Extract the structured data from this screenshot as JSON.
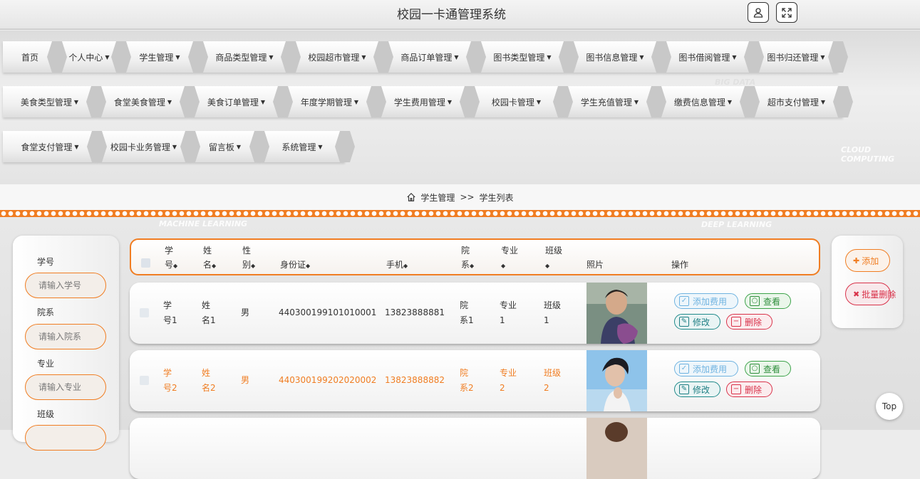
{
  "header": {
    "title": "校园一卡通管理系统",
    "user_icon": "user-icon",
    "fullscreen_icon": "expand-icon"
  },
  "nav": {
    "rows": [
      [
        {
          "label": "首页",
          "dropdown": false
        },
        {
          "label": "个人中心",
          "dropdown": true
        },
        {
          "label": "学生管理",
          "dropdown": true
        },
        {
          "label": "商品类型管理",
          "dropdown": true
        },
        {
          "label": "校园超市管理",
          "dropdown": true
        },
        {
          "label": "商品订单管理",
          "dropdown": true
        },
        {
          "label": "图书类型管理",
          "dropdown": true
        },
        {
          "label": "图书信息管理",
          "dropdown": true
        },
        {
          "label": "图书借阅管理",
          "dropdown": true
        },
        {
          "label": "图书归还管理",
          "dropdown": true
        }
      ],
      [
        {
          "label": "美食类型管理",
          "dropdown": true
        },
        {
          "label": "食堂美食管理",
          "dropdown": true
        },
        {
          "label": "美食订单管理",
          "dropdown": true
        },
        {
          "label": "年度学期管理",
          "dropdown": true
        },
        {
          "label": "学生费用管理",
          "dropdown": true
        },
        {
          "label": "校园卡管理",
          "dropdown": true
        },
        {
          "label": "学生充值管理",
          "dropdown": true
        },
        {
          "label": "缴费信息管理",
          "dropdown": true
        },
        {
          "label": "超市支付管理",
          "dropdown": true
        }
      ],
      [
        {
          "label": "食堂支付管理",
          "dropdown": true
        },
        {
          "label": "校园卡业务管理",
          "dropdown": true
        },
        {
          "label": "留言板",
          "dropdown": true
        },
        {
          "label": "系统管理",
          "dropdown": true
        }
      ]
    ],
    "deco": [
      "CLOUD COMPUTING",
      "BIG DATA",
      "MACHINE LEARNING",
      "DEEP LEARNING"
    ]
  },
  "breadcrumb": {
    "icon": "home-icon",
    "section": "学生管理",
    "sep": ">>",
    "page": "学生列表"
  },
  "search": {
    "fields": [
      {
        "label": "学号",
        "placeholder": "请输入学号"
      },
      {
        "label": "院系",
        "placeholder": "请输入院系"
      },
      {
        "label": "专业",
        "placeholder": "请输入专业"
      },
      {
        "label": "班级",
        "placeholder": ""
      }
    ]
  },
  "actions": {
    "add": "添加",
    "batch_delete": "批量删除"
  },
  "table": {
    "headers": {
      "xuehao": [
        "学",
        "号"
      ],
      "name": [
        "姓",
        "名"
      ],
      "gender": [
        "性",
        "别"
      ],
      "idcard": "身份证",
      "phone": "手机",
      "college": [
        "院",
        "系"
      ],
      "major": [
        "专业",
        ""
      ],
      "class": [
        "班级",
        ""
      ],
      "photo": "照片",
      "ops": "操作"
    },
    "rows": [
      {
        "xuehao": [
          "学",
          "号1"
        ],
        "name": [
          "姓",
          "名1"
        ],
        "gender": "男",
        "idcard": "440300199101010001",
        "phone": "13823888881",
        "college": [
          "院",
          "系1"
        ],
        "major": [
          "专业",
          "1"
        ],
        "class": [
          "班级",
          "1"
        ]
      },
      {
        "xuehao": [
          "学",
          "号2"
        ],
        "name": [
          "姓",
          "名2"
        ],
        "gender": "男",
        "idcard": "440300199202020002",
        "phone": "13823888882",
        "college": [
          "院",
          "系2"
        ],
        "major": [
          "专业",
          "2"
        ],
        "class": [
          "班级",
          "2"
        ]
      }
    ],
    "row_buttons": {
      "fee": "添加费用",
      "view": "查看",
      "edit": "修改",
      "delete": "删除"
    }
  },
  "top_button": "Top",
  "colors": {
    "accent": "#f07d22",
    "danger": "#d9324a",
    "success": "#3ca349",
    "info": "#6fb3e0",
    "teal": "#1f8a8a"
  }
}
